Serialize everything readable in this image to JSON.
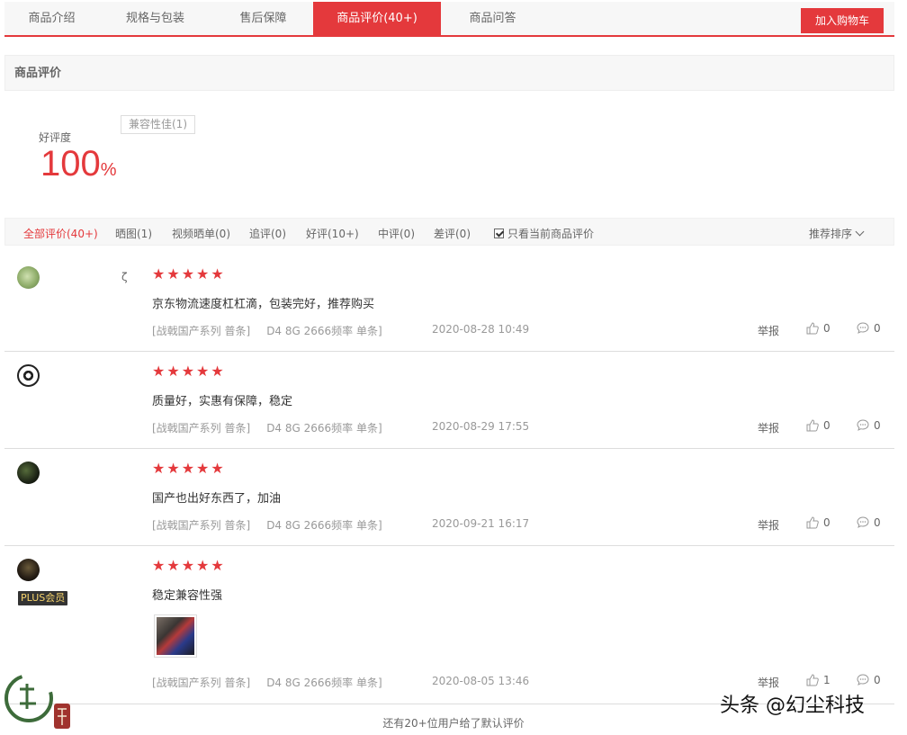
{
  "tabs": [
    {
      "label": "商品介绍"
    },
    {
      "label": "规格与包装"
    },
    {
      "label": "售后保障"
    },
    {
      "label": "商品评价(40+)"
    },
    {
      "label": "商品问答"
    }
  ],
  "cart_button": "加入购物车",
  "section_title": "商品评价",
  "summary": {
    "rate_label": "好评度",
    "rate_value": "100",
    "rate_unit": "%",
    "tags": [
      "兼容性佳(1)"
    ]
  },
  "filters": {
    "items": [
      "全部评价(40+)",
      "晒图(1)",
      "视频晒单(0)",
      "追评(0)",
      "好评(10+)",
      "中评(0)",
      "差评(0)"
    ],
    "only_current": "只看当前商品评价",
    "only_current_checked": true,
    "sort": "推荐排序"
  },
  "reviews": [
    {
      "stars": 5,
      "content": "京东物流速度杠杠滴，包装完好，推荐购买",
      "series": "[战戟国产系列 普条]",
      "spec": "D4 8G 2666频率 单条]",
      "date": "2020-08-28 10:49",
      "report": "举报",
      "likes": "0",
      "comments": "0",
      "username_partial": "ζ"
    },
    {
      "stars": 5,
      "content": "质量好，实惠有保障，稳定",
      "series": "[战戟国产系列 普条]",
      "spec": "D4 8G 2666频率 单条]",
      "date": "2020-08-29 17:55",
      "report": "举报",
      "likes": "0",
      "comments": "0"
    },
    {
      "stars": 5,
      "content": "国产也出好东西了，加油",
      "series": "[战戟国产系列 普条]",
      "spec": "D4 8G 2666频率 单条]",
      "date": "2020-09-21 16:17",
      "report": "举报",
      "likes": "0",
      "comments": "0"
    },
    {
      "stars": 5,
      "content": "稳定兼容性强",
      "series": "[战戟国产系列 普条]",
      "spec": "D4 8G 2666频率 单条]",
      "date": "2020-08-05 13:46",
      "report": "举报",
      "likes": "1",
      "comments": "0",
      "badge": "PLUS会员"
    }
  ],
  "footer_note": "还有20+位用户给了默认评价",
  "watermark_text": "头条 @幻尘科技",
  "colors": {
    "accent": "#e4393c",
    "muted": "#999999",
    "bar_bg": "#f7f7f7"
  }
}
